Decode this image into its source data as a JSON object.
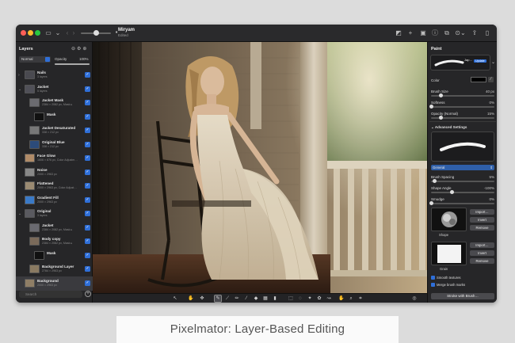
{
  "window": {
    "document_title": "Miryam",
    "document_subtitle": "Edited"
  },
  "layers_panel": {
    "title": "Layers",
    "blend_mode": "Normal",
    "opacity_label": "Opacity",
    "opacity_value": "100%",
    "opacity_level": 1.0,
    "search_placeholder": "Search",
    "layers": [
      {
        "name": "Nails",
        "sub": "3 layers",
        "indent": 0,
        "group": true,
        "thumb": "#4a4a50"
      },
      {
        "name": "Jacket",
        "sub": "5 layers",
        "indent": 0,
        "group": true,
        "thumb": "#505058"
      },
      {
        "name": "Jacket Mask",
        "sub": "2384 × 2082 px, Mask ▸",
        "indent": 1,
        "group": false,
        "thumb": "#6b6b70"
      },
      {
        "name": "Mask",
        "sub": "",
        "indent": 2,
        "group": false,
        "thumb": "#111111"
      },
      {
        "name": "Jacket Desaturated",
        "sub": "338 × 212 px",
        "indent": 1,
        "group": false,
        "thumb": "#777777"
      },
      {
        "name": "Original Blue",
        "sub": "338 × 212 px",
        "indent": 1,
        "group": false,
        "thumb": "#2c4b7a"
      },
      {
        "name": "Face Glow",
        "sub": "1606 × 876 px, Color Adjustm…",
        "indent": 0,
        "group": false,
        "thumb": "#b08b68"
      },
      {
        "name": "Noise",
        "sub": "2000 × 2963 px",
        "indent": 0,
        "group": false,
        "thumb": "#888888"
      },
      {
        "name": "Flattened",
        "sub": "2000 × 2963 px, Color Adjust…",
        "indent": 0,
        "group": false,
        "thumb": "#9a8a72"
      },
      {
        "name": "Gradient Fill",
        "sub": "2000 × 2963 px",
        "indent": 0,
        "group": false,
        "thumb": "#3a7ac8"
      },
      {
        "name": "Original",
        "sub": "3 layers",
        "indent": 0,
        "group": true,
        "thumb": "#5a5a60"
      },
      {
        "name": "Jacket",
        "sub": "2384 × 2082 px, Mask ▸",
        "indent": 1,
        "group": false,
        "thumb": "#6a6a70"
      },
      {
        "name": "Body copy",
        "sub": "2384 × 2082 px, Mask ▸",
        "indent": 1,
        "group": false,
        "thumb": "#7a6a5a"
      },
      {
        "name": "Mask",
        "sub": "",
        "indent": 2,
        "group": false,
        "thumb": "#111111"
      },
      {
        "name": "Background Layer",
        "sub": "2784 × 2963 px",
        "indent": 1,
        "group": false,
        "thumb": "#8a7a62"
      },
      {
        "name": "Background",
        "sub": "2000 × 2963 px",
        "indent": 0,
        "group": false,
        "thumb": "#8f7e66"
      }
    ]
  },
  "paint_panel": {
    "title": "Paint",
    "brush_name": "Jap…",
    "brush_badge": "Update",
    "color_label": "Color",
    "brush_size_label": "Brush Size",
    "brush_size_value": "40 px",
    "brush_size_level": 0.15,
    "softness_label": "Softness",
    "softness_value": "0%",
    "softness_level": 0.0,
    "opacity_label": "Opacity (Normal)",
    "opacity_value": "15%",
    "opacity_level": 0.15,
    "advanced_label": "Advanced Settings",
    "preset": "General",
    "spacing_label": "Brush Spacing",
    "spacing_value": "5%",
    "spacing_level": 0.05,
    "angle_label": "Shape Angle",
    "angle_value": "-100%",
    "angle_level": 0.32,
    "smudge_label": "Smudge",
    "smudge_value": "0%",
    "smudge_level": 0.0,
    "shape_label": "Shape",
    "grain_label": "Grain",
    "import_label": "Import…",
    "invert_label": "Invert",
    "remove_label": "Remove",
    "smooth_label": "Smooth textures",
    "merge_label": "Merge brush marks",
    "stroke_button": "Stroke with Brush…"
  },
  "caption": "Pixelmator: Layer-Based Editing",
  "colors": {
    "accent": "#2f6fd8",
    "close": "#ff5f57",
    "minimize": "#febc2e",
    "zoom": "#28c840"
  }
}
